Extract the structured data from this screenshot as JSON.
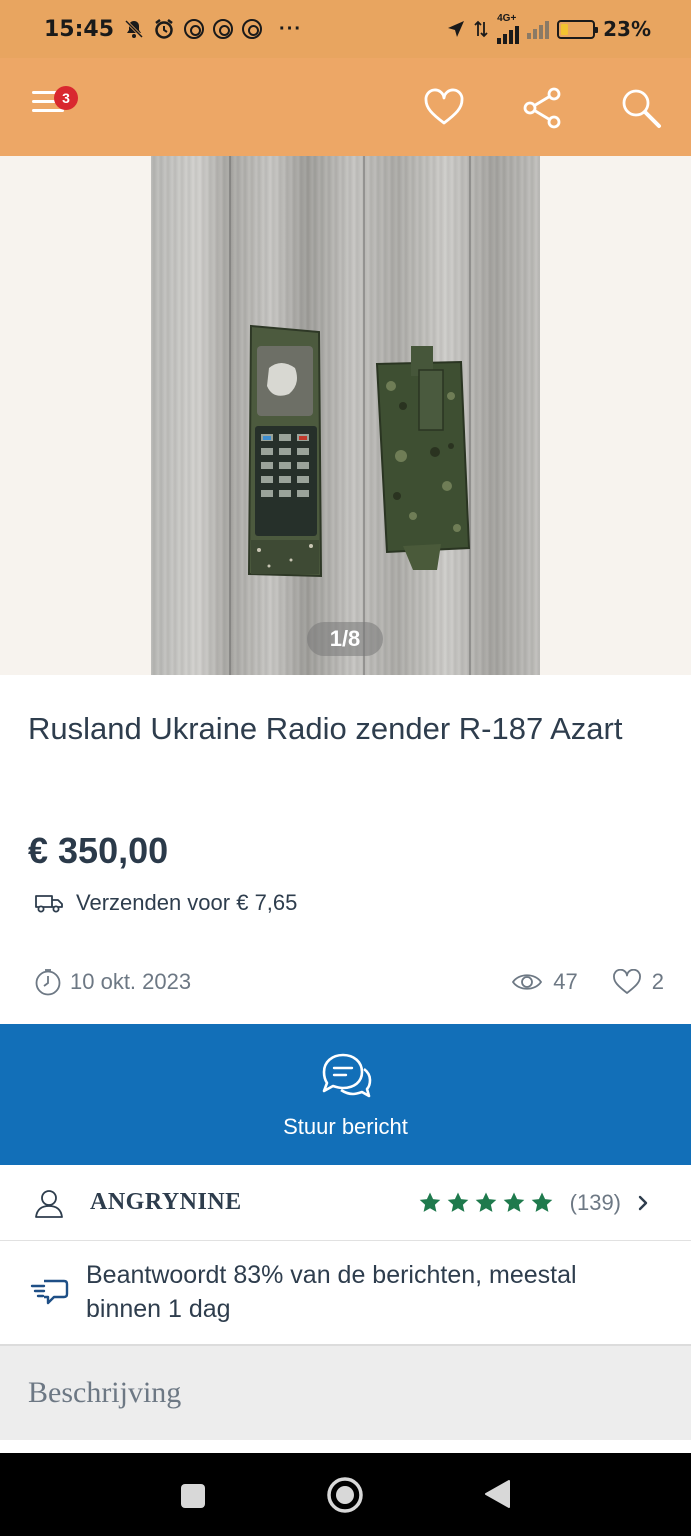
{
  "status_bar": {
    "time": "15:45",
    "network": "4G+",
    "battery_percent": "23%",
    "battery_level": 0.23
  },
  "app_bar": {
    "notification_count": "3"
  },
  "gallery": {
    "counter": "1/8"
  },
  "listing": {
    "title": "Rusland Ukraine Radio zender R-187 Azart",
    "price": "€ 350,00",
    "shipping": "Verzenden voor € 7,65",
    "date": "10 okt. 2023",
    "views": "47",
    "favorites": "2"
  },
  "message_button": {
    "label": "Stuur bericht"
  },
  "seller": {
    "name": "ANGRYNINE",
    "rating_stars": 5,
    "review_count": "(139)"
  },
  "response": {
    "text": "Beantwoordt 83% van de berichten, meestal binnen 1 dag"
  },
  "description": {
    "heading": "Beschrijving"
  },
  "colors": {
    "accent": "#eda766",
    "primary_blue": "#126fb8",
    "star_green": "#1f7a4d",
    "badge_red": "#d9282f"
  }
}
